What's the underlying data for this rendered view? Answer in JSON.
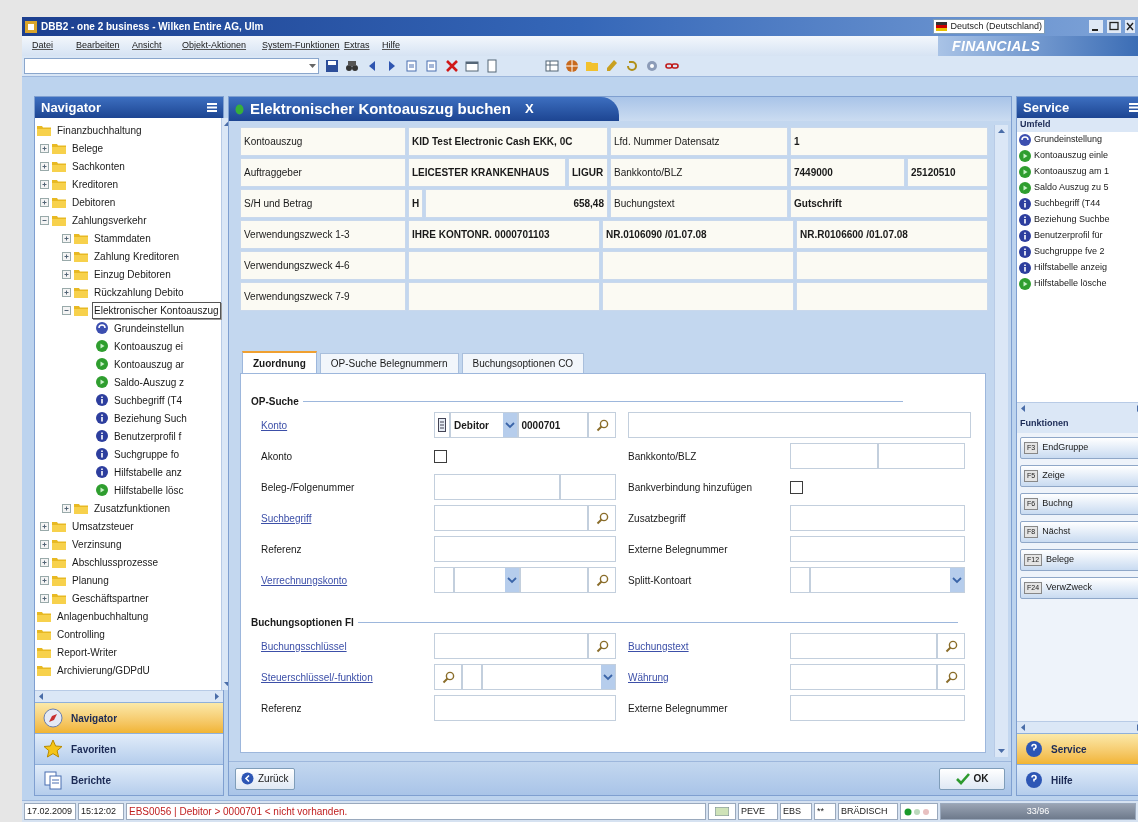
{
  "window": {
    "title": "DBB2 - one 2 business - Wilken Entire AG, Ulm",
    "language": "Deutsch (Deutschland)",
    "brand": "FINANCIALS"
  },
  "menu": [
    "Datei",
    "Bearbeiten",
    "Ansicht",
    "Objekt-Aktionen",
    "System-Funktionen",
    "Extras",
    "Hilfe"
  ],
  "navigator": {
    "title": "Navigator",
    "tree": [
      {
        "label": "Finanzbuchhaltung",
        "kind": "folder",
        "selected": false,
        "children": [
          {
            "label": "Belege",
            "kind": "folder",
            "selected": false,
            "expanded": false
          },
          {
            "label": "Sachkonten",
            "kind": "folder",
            "selected": false,
            "expanded": false
          },
          {
            "label": "Kreditoren",
            "kind": "folder",
            "selected": false,
            "expanded": false
          },
          {
            "label": "Debitoren",
            "kind": "folder",
            "selected": false,
            "expanded": false
          },
          {
            "label": "Zahlungsverkehr",
            "kind": "folder",
            "selected": false,
            "expanded": true,
            "children": [
              {
                "label": "Stammdaten",
                "kind": "folder",
                "selected": false,
                "expanded": false
              },
              {
                "label": "Zahlung Kreditoren",
                "kind": "folder",
                "selected": false,
                "expanded": false
              },
              {
                "label": "Einzug Debitoren",
                "kind": "folder",
                "selected": false,
                "expanded": false
              },
              {
                "label": "Rückzahlung Debito",
                "kind": "folder",
                "selected": false,
                "expanded": false
              },
              {
                "label": "Elektronischer Kontoauszug",
                "kind": "folder",
                "selected": true,
                "expanded": true,
                "children": [
                  {
                    "label": "Grundeinstellun",
                    "kind": "setup",
                    "selected": false
                  },
                  {
                    "label": "Kontoauszug ei",
                    "kind": "run",
                    "selected": false
                  },
                  {
                    "label": "Kontoauszug ar",
                    "kind": "run",
                    "selected": false
                  },
                  {
                    "label": "Saldo-Auszug z",
                    "kind": "run",
                    "selected": false
                  },
                  {
                    "label": "Suchbegriff (T4",
                    "kind": "info",
                    "selected": false
                  },
                  {
                    "label": "Beziehung Such",
                    "kind": "info",
                    "selected": false
                  },
                  {
                    "label": "Benutzerprofil f",
                    "kind": "info",
                    "selected": false
                  },
                  {
                    "label": "Suchgruppe fo",
                    "kind": "info",
                    "selected": false
                  },
                  {
                    "label": "Hilfstabelle anz",
                    "kind": "info",
                    "selected": false
                  },
                  {
                    "label": "Hilfstabelle lösc",
                    "kind": "run",
                    "selected": false
                  }
                ]
              },
              {
                "label": "Zusatzfunktionen",
                "kind": "folder",
                "selected": false,
                "expanded": false
              }
            ]
          },
          {
            "label": "Umsatzsteuer",
            "kind": "folder",
            "selected": false,
            "expanded": false
          },
          {
            "label": "Verzinsung",
            "kind": "folder",
            "selected": false,
            "expanded": false
          },
          {
            "label": "Abschlussprozesse",
            "kind": "folder",
            "selected": false,
            "expanded": false
          },
          {
            "label": "Planung",
            "kind": "folder",
            "selected": false,
            "expanded": false
          },
          {
            "label": "Geschäftspartner",
            "kind": "folder",
            "selected": false,
            "expanded": false
          }
        ]
      },
      {
        "label": "Anlagenbuchhaltung",
        "kind": "folder",
        "selected": false
      },
      {
        "label": "Controlling",
        "kind": "folder",
        "selected": false
      },
      {
        "label": "Report-Writer",
        "kind": "folder",
        "selected": false
      },
      {
        "label": "Archivierung/GDPdU",
        "kind": "folder",
        "selected": false
      }
    ],
    "sections": [
      {
        "label": "Navigator",
        "kind": "navigator",
        "selected": true
      },
      {
        "label": "Favoriten",
        "kind": "favorites",
        "selected": false
      },
      {
        "label": "Berichte",
        "kind": "reports",
        "selected": false
      }
    ]
  },
  "document": {
    "title": "Elektronischer Kontoauszug buchen",
    "close": "X",
    "header_rows": [
      {
        "kind": "pair",
        "cells": [
          "Kontoauszug",
          "KID Test Electronic Cash EKK, 0C",
          "Lfd. Nummer Datensatz",
          "1"
        ]
      },
      {
        "kind": "split",
        "cells": [
          "Auftraggeber",
          "LEICESTER KRANKENHAUS",
          "LIGUR",
          "Bankkonto/BLZ",
          "7449000",
          "25120510"
        ]
      },
      {
        "kind": "amount",
        "cells": [
          "S/H und Betrag",
          "H",
          "658,48",
          "Buchungstext",
          "Gutschrift"
        ]
      },
      {
        "kind": "triple",
        "cells": [
          "Verwendungszweck 1-3",
          "IHRE KONTONR. 0000701103",
          "NR.0106090 /01.07.08",
          "NR.R0106600 /01.07.08"
        ]
      },
      {
        "kind": "triple",
        "cells": [
          "Verwendungszweck 4-6"
        ]
      },
      {
        "kind": "triple",
        "cells": [
          "Verwendungszweck 7-9"
        ]
      }
    ],
    "tabs": [
      {
        "label": "Zuordnung",
        "selected": true
      },
      {
        "label": "OP-Suche Belegnummern",
        "selected": false
      },
      {
        "label": "Buchungsoptionen CO",
        "selected": false
      }
    ],
    "sections": [
      {
        "title": "OP-Suche",
        "rows": [
          {
            "left": {
              "label": "Konto",
              "link": true,
              "parts": [
                {
                  "kind": "type"
                },
                {
                  "kind": "select",
                  "value": "Debitor"
                },
                {
                  "kind": "field",
                  "value": "0000701"
                },
                {
                  "kind": "search"
                }
              ]
            },
            "right": {
              "parts": [
                {
                  "kind": "field"
                }
              ]
            }
          },
          {
            "left": {
              "label": "Akonto",
              "link": false,
              "parts": [
                {
                  "kind": "checkbox",
                  "checked": false
                }
              ]
            },
            "right": {
              "label": "Bankkonto/BLZ",
              "link": false,
              "parts": [
                {
                  "kind": "field"
                },
                {
                  "kind": "field"
                }
              ]
            }
          },
          {
            "left": {
              "label": "Beleg-/Folgenummer",
              "link": false,
              "parts": [
                {
                  "kind": "field"
                },
                {
                  "kind": "short"
                }
              ]
            },
            "right": {
              "label": "Bankverbindung hinzufügen",
              "link": false,
              "parts": [
                {
                  "kind": "checkbox",
                  "checked": false
                }
              ]
            }
          },
          {
            "left": {
              "label": "Suchbegriff",
              "link": true,
              "parts": [
                {
                  "kind": "field"
                },
                {
                  "kind": "search"
                }
              ]
            },
            "right": {
              "label": "Zusatzbegriff",
              "link": false,
              "parts": [
                {
                  "kind": "field"
                }
              ]
            }
          },
          {
            "left": {
              "label": "Referenz",
              "link": false,
              "parts": [
                {
                  "kind": "field"
                }
              ]
            },
            "right": {
              "label": "Externe Belegnummer",
              "link": false,
              "parts": [
                {
                  "kind": "field"
                }
              ]
            }
          },
          {
            "left": {
              "label": "Verrechnungskonto",
              "link": true,
              "parts": [
                {
                  "kind": "tiny"
                },
                {
                  "kind": "select"
                },
                {
                  "kind": "field"
                },
                {
                  "kind": "search"
                }
              ]
            },
            "right": {
              "label": "Splitt-Kontoart",
              "link": false,
              "parts": [
                {
                  "kind": "tiny"
                },
                {
                  "kind": "select"
                }
              ]
            }
          }
        ]
      },
      {
        "title": "Buchungsoptionen FI",
        "rows": [
          {
            "left": {
              "label": "Buchungsschlüssel",
              "link": true,
              "parts": [
                {
                  "kind": "field"
                },
                {
                  "kind": "search"
                }
              ]
            },
            "right": {
              "label": "Buchungstext",
              "link": true,
              "parts": [
                {
                  "kind": "field"
                },
                {
                  "kind": "search"
                }
              ]
            }
          },
          {
            "left": {
              "label": "Steuerschlüssel/-funktion",
              "link": true,
              "parts": [
                {
                  "kind": "search"
                },
                {
                  "kind": "tiny"
                },
                {
                  "kind": "select"
                }
              ]
            },
            "right": {
              "label": "Währung",
              "link": true,
              "parts": [
                {
                  "kind": "field"
                },
                {
                  "kind": "search"
                }
              ]
            }
          },
          {
            "left": {
              "label": "Referenz",
              "link": false,
              "parts": [
                {
                  "kind": "field"
                }
              ]
            },
            "right": {
              "label": "Externe Belegnummer",
              "link": false,
              "parts": [
                {
                  "kind": "field"
                }
              ]
            }
          }
        ]
      }
    ],
    "back_button": "Zurück",
    "ok_button": "OK"
  },
  "service": {
    "title": "Service",
    "context_title": "Umfeld",
    "items": [
      {
        "label": "Grundeinstellung",
        "kind": "setup"
      },
      {
        "label": "Kontoauszug einle",
        "kind": "run"
      },
      {
        "label": "Kontoauszug am 1",
        "kind": "run"
      },
      {
        "label": "Saldo Auszug zu 5",
        "kind": "run"
      },
      {
        "label": "Suchbegriff (T44",
        "kind": "info"
      },
      {
        "label": "Beziehung Suchbe",
        "kind": "info"
      },
      {
        "label": "Benutzerprofil für",
        "kind": "info"
      },
      {
        "label": "Suchgruppe fve 2",
        "kind": "info"
      },
      {
        "label": "Hilfstabelle anzeig",
        "kind": "info"
      },
      {
        "label": "Hilfstabelle lösche",
        "kind": "run"
      }
    ],
    "functions_title": "Funktionen",
    "functions": [
      {
        "key": "F3",
        "label": "EndGruppe"
      },
      {
        "key": "F5",
        "label": "Zeige"
      },
      {
        "key": "F6",
        "label": "Buchng"
      },
      {
        "key": "F8",
        "label": "Nächst"
      },
      {
        "key": "F12",
        "label": "Belege"
      },
      {
        "key": "F24",
        "label": "VerwZweck"
      }
    ],
    "sections": [
      {
        "label": "Service",
        "selected": true
      },
      {
        "label": "Hilfe",
        "selected": false
      }
    ]
  },
  "status_bar": {
    "date": "17.02.2009",
    "time": "15:12:02",
    "message": "EBS0056 | Debitor > 0000701 < nicht vorhanden.",
    "user": "PEVE",
    "module": "EBS",
    "flag": "**",
    "name": "BRÄDISCH",
    "progress": "33/96"
  }
}
